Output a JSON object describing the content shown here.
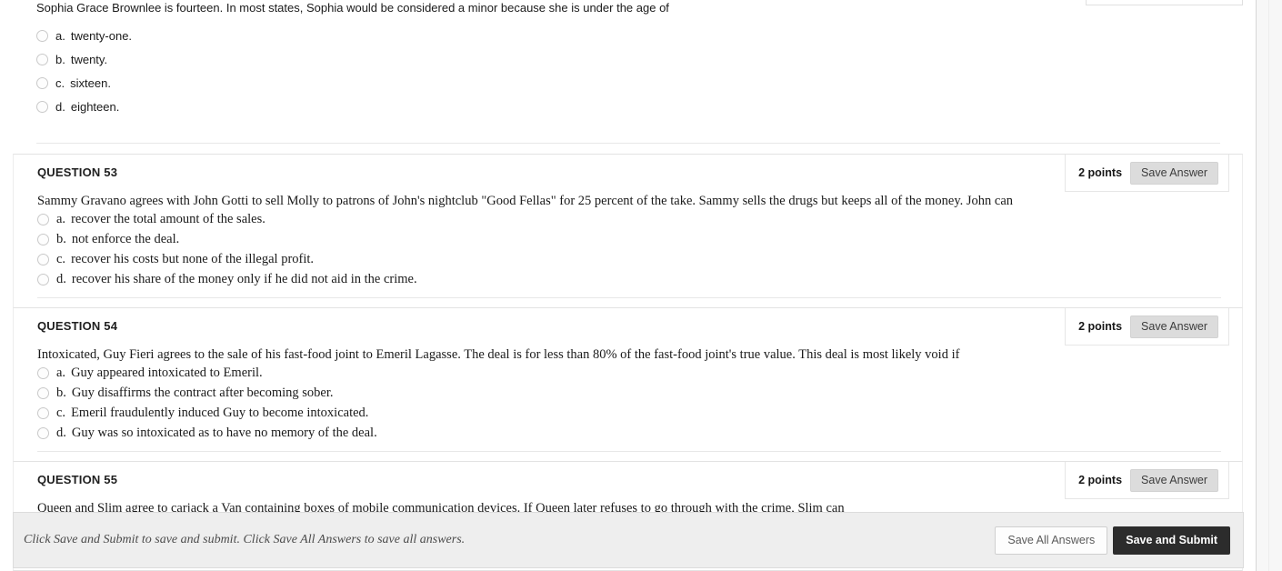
{
  "page": {
    "top_question": {
      "stem": "Sophia Grace Brownlee is fourteen. In most states, Sophia would be considered a minor because she is under the age of",
      "choices": [
        {
          "letter": "a.",
          "text": "twenty-one."
        },
        {
          "letter": "b.",
          "text": "twenty."
        },
        {
          "letter": "c.",
          "text": "sixteen."
        },
        {
          "letter": "d.",
          "text": "eighteen."
        }
      ]
    },
    "questions": [
      {
        "title": "QUESTION 53",
        "points_label": "2 points",
        "save_answer_label": "Save Answer",
        "stem": "Sammy Gravano agrees with John Gotti to sell Molly to patrons of John's nightclub \"Good Fellas\" for 25 percent of the take. Sammy sells the drugs but keeps all of the money. John can",
        "choices": [
          {
            "letter": "a.",
            "text": "recover the total amount of the sales."
          },
          {
            "letter": "b.",
            "text": "not enforce the deal."
          },
          {
            "letter": "c.",
            "text": "recover his costs but none of the illegal profit."
          },
          {
            "letter": "d.",
            "text": "recover his share of the money only if he did not aid in the crime."
          }
        ]
      },
      {
        "title": "QUESTION 54",
        "points_label": "2 points",
        "save_answer_label": "Save Answer",
        "stem": "Intoxicated, Guy Fieri agrees to the sale of his fast-food joint to Emeril Lagasse.  The deal is for less than 80% of the fast-food joint's true value.   This deal is most likely void if",
        "choices": [
          {
            "letter": "a.",
            "text": "Guy appeared intoxicated to Emeril."
          },
          {
            "letter": "b.",
            "text": "Guy disaffirms the contract after becoming sober."
          },
          {
            "letter": "c.",
            "text": "Emeril fraudulently induced Guy to become intoxicated."
          },
          {
            "letter": "d.",
            "text": "Guy was so intoxicated as to have no memory of the deal."
          }
        ]
      },
      {
        "title": "QUESTION 55",
        "points_label": "2 points",
        "save_answer_label": "Save Answer",
        "stem": "Queen and Slim agree to carjack a Van containing boxes of mobile communication devices. If Queen later refuses to go through with the crime, Slim can",
        "choices": []
      }
    ],
    "bottom_bar": {
      "hint": "Click Save and Submit to save and submit. Click Save All Answers to save all answers.",
      "save_all_label": "Save All Answers",
      "save_submit_label": "Save and Submit"
    }
  }
}
